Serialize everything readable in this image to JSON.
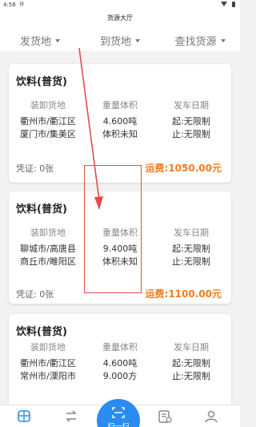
{
  "status_bar": {
    "time": "4:58"
  },
  "header": {
    "title": "货源大厅"
  },
  "filters": [
    {
      "label": "发货地"
    },
    {
      "label": "到货地"
    },
    {
      "label": "查找货源"
    }
  ],
  "cards": [
    {
      "title": "饮料(普货)",
      "col_headers": [
        "装卸货地",
        "重量体积",
        "发车日期"
      ],
      "origin": "衢州市/衢江区",
      "destination": "厦门市/集美区",
      "weight": "4.600吨",
      "volume": "体积未知",
      "start": "起:无限制",
      "end": "止:无限制",
      "voucher": "凭证: 0张",
      "freight": "运费:1050.00元"
    },
    {
      "title": "饮料(普货)",
      "col_headers": [
        "装卸货地",
        "重量体积",
        "发车日期"
      ],
      "origin": "聊城市/高唐县",
      "destination": "商丘市/睢阳区",
      "weight": "9.400吨",
      "volume": "体积未知",
      "start": "起:无限制",
      "end": "止:无限制",
      "voucher": "凭证: 0张",
      "freight": "运费:1100.00元"
    },
    {
      "title": "饮料(普货)",
      "col_headers": [
        "装卸货地",
        "重量体积",
        "发车日期"
      ],
      "origin": "衢州市/衢江区",
      "destination": "常州市/溧阳市",
      "weight": "4.600吨",
      "volume": "9.000方",
      "start": "起:无限制",
      "end": "止:无限制"
    }
  ],
  "tabbar": {
    "scan_label": "扫一扫",
    "active_color": "#2a8cf0",
    "icons": [
      "hall-icon",
      "routes-icon",
      "scan-icon",
      "orders-icon",
      "profile-icon"
    ]
  },
  "colors": {
    "freight": "#f47c20",
    "annotation": "#e24d4d"
  }
}
